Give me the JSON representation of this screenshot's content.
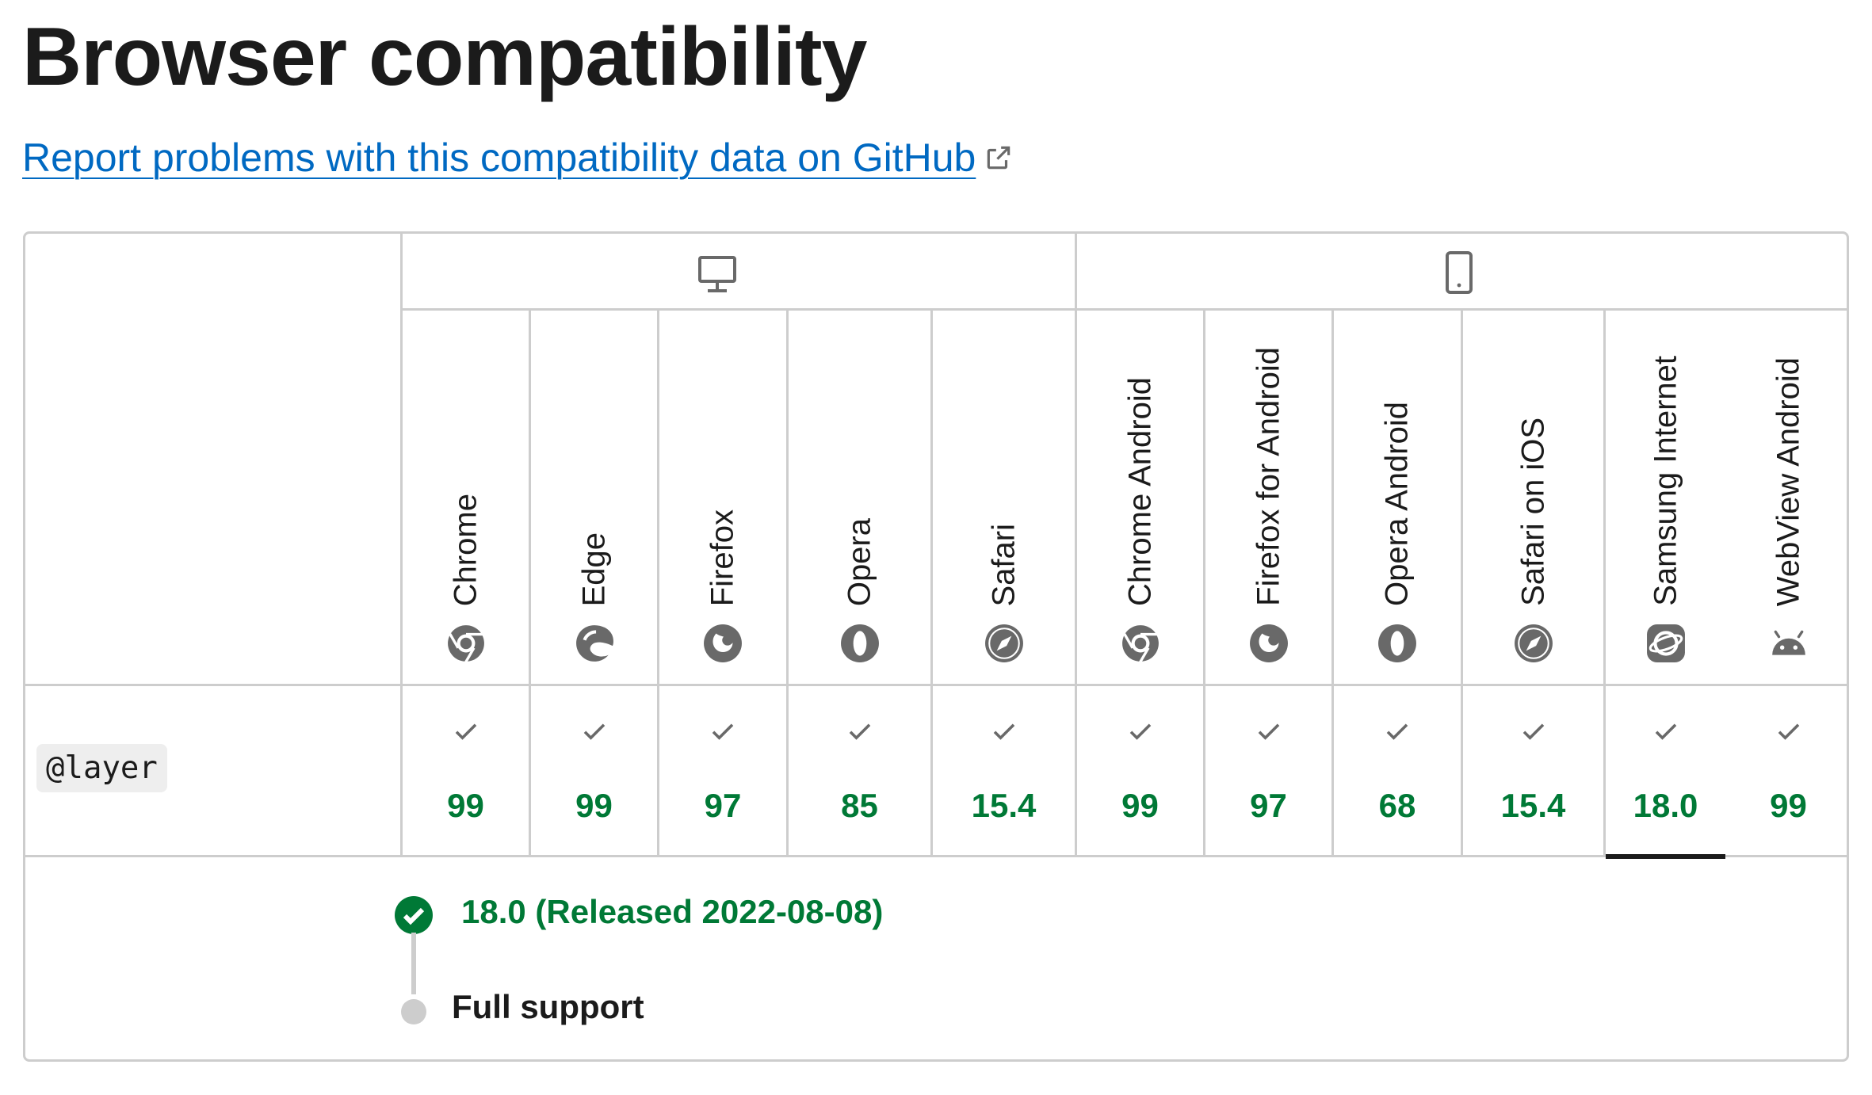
{
  "page": {
    "title": "Browser compatibility",
    "report_link": "Report problems with this compatibility data on GitHub",
    "report_link_icon": "external-link-icon"
  },
  "table": {
    "platforms": [
      {
        "name": "desktop",
        "icon": "desktop-icon"
      },
      {
        "name": "mobile",
        "icon": "mobile-icon"
      }
    ],
    "browsers": [
      {
        "name": "Chrome",
        "icon": "chrome-icon"
      },
      {
        "name": "Edge",
        "icon": "edge-icon"
      },
      {
        "name": "Firefox",
        "icon": "firefox-icon"
      },
      {
        "name": "Opera",
        "icon": "opera-icon"
      },
      {
        "name": "Safari",
        "icon": "safari-icon"
      },
      {
        "name": "Chrome Android",
        "icon": "chrome-icon"
      },
      {
        "name": "Firefox for Android",
        "icon": "firefox-icon"
      },
      {
        "name": "Opera Android",
        "icon": "opera-icon"
      },
      {
        "name": "Safari on iOS",
        "icon": "safari-icon"
      },
      {
        "name": "Samsung Internet",
        "icon": "samsung-internet-icon"
      },
      {
        "name": "WebView Android",
        "icon": "android-icon"
      }
    ],
    "feature": "@layer",
    "support": [
      {
        "status": "full",
        "version": "99"
      },
      {
        "status": "full",
        "version": "99"
      },
      {
        "status": "full",
        "version": "97"
      },
      {
        "status": "full",
        "version": "85"
      },
      {
        "status": "full",
        "version": "15.4"
      },
      {
        "status": "full",
        "version": "99"
      },
      {
        "status": "full",
        "version": "97"
      },
      {
        "status": "full",
        "version": "68"
      },
      {
        "status": "full",
        "version": "15.4"
      },
      {
        "status": "full",
        "version": "18.0"
      },
      {
        "status": "full",
        "version": "99"
      }
    ],
    "expanded_index": 9,
    "details": {
      "release": "18.0 (Released 2022-08-08)",
      "support_label": "Full support"
    }
  },
  "colors": {
    "link": "#0069c2",
    "support_green": "#007936",
    "border": "#cdcdcd",
    "text": "#1b1b1b"
  }
}
